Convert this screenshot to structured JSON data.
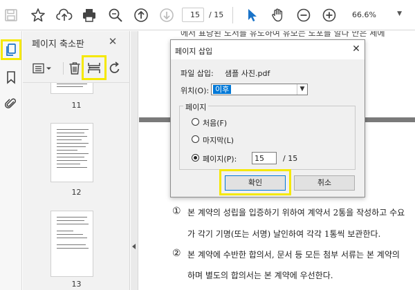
{
  "toolbar": {
    "current_page": "15",
    "total_pages": "/ 15",
    "zoom": "66.6%"
  },
  "panel": {
    "title": "페이지 축소판",
    "close": "✕",
    "thumbnails": [
      {
        "page": "11"
      },
      {
        "page": "12"
      },
      {
        "page": "13"
      }
    ]
  },
  "document": {
    "top_line": "에서 표당된 도서를 유도하여 유모는 도포를 알다 만은 세에",
    "clause1_num": "①",
    "clause1_line1": "본 계약의 성립을 입증하기 위하여 계약서 2통을 작성하고 수요",
    "clause1_line2": "가 각기 기명(또는 서명) 날인하여 각각 1통씩 보관한다.",
    "clause2_num": "②",
    "clause2_line1": "본 계약에 수반한 합의서, 문서 등 모든 첨부 서류는 본 계약의",
    "clause2_line2": "하며 별도의 합의서는 본 계약에 우선한다."
  },
  "dialog": {
    "title": "페이지 삽입",
    "close": "✕",
    "file_label": "파일 삽입:",
    "file_name": "샘플 사진.pdf",
    "location_label": "위치(O):",
    "location_value": "이후",
    "group_title": "페이지",
    "option_first": "처음(F)",
    "option_last": "마지막(L)",
    "option_page": "페이지(P):",
    "page_value": "15",
    "page_total": "/ 15",
    "ok_label": "확인",
    "cancel_label": "취소"
  },
  "colors": {
    "highlight": "#f5e800",
    "accent_blue": "#1a73c8",
    "select_blue": "#0078d7"
  }
}
